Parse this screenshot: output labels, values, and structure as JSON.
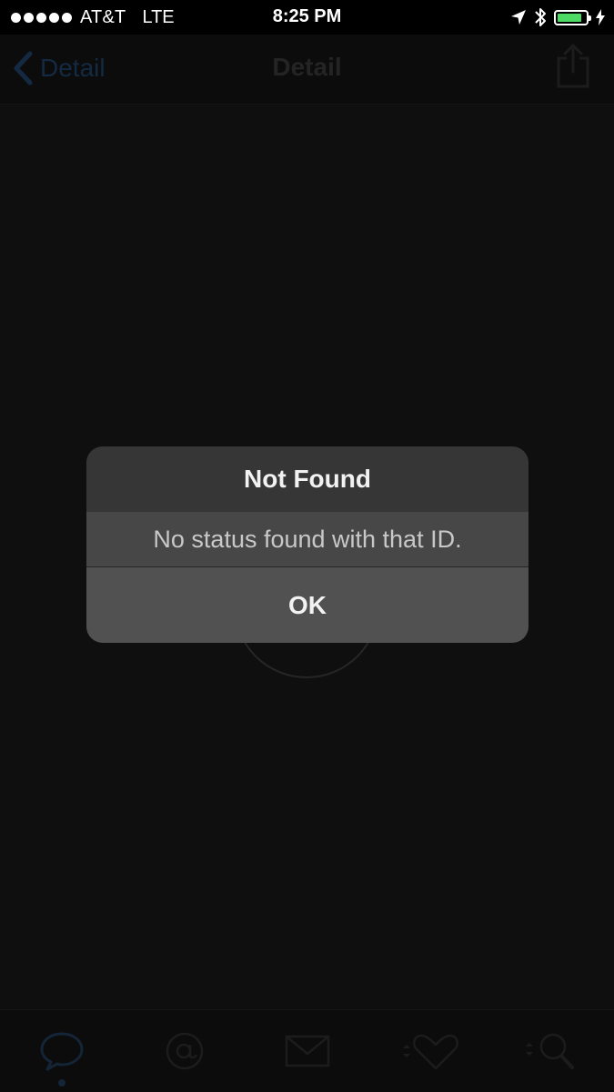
{
  "status_bar": {
    "carrier": "AT&T",
    "network": "LTE",
    "time": "8:25 PM",
    "signal_bars": 5,
    "battery_level": 0.85,
    "battery_color": "#4cd964"
  },
  "nav": {
    "back_label": "Detail",
    "title": "Detail"
  },
  "alert": {
    "title": "Not Found",
    "message": "No status found with that ID.",
    "ok_label": "OK"
  },
  "tabs": [
    {
      "icon": "speech-bubble-icon",
      "selected": true
    },
    {
      "icon": "at-sign-icon",
      "selected": false
    },
    {
      "icon": "envelope-icon",
      "selected": false
    },
    {
      "icon": "heart-icon",
      "selected": false
    },
    {
      "icon": "search-icon",
      "selected": false
    }
  ],
  "colors": {
    "accent_dim": "#142a42",
    "background": "#0f0f0f"
  }
}
